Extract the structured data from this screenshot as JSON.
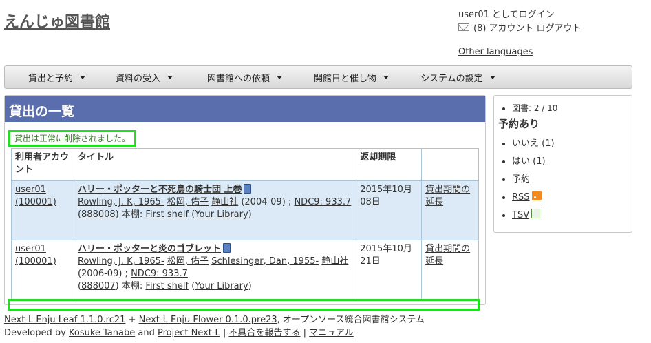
{
  "site": {
    "title": "えんじゅ図書館"
  },
  "user": {
    "login_text": "user01 としてログイン",
    "message_count": "(8)",
    "account_link": "アカウント",
    "logout_link": "ログアウト",
    "other_languages": "Other languages"
  },
  "nav": {
    "items": [
      {
        "label": "貸出と予約"
      },
      {
        "label": "資料の受入"
      },
      {
        "label": "図書館への依頼"
      },
      {
        "label": "開館日と催し物"
      },
      {
        "label": "システムの設定"
      }
    ]
  },
  "main": {
    "heading": "貸出の一覧",
    "notice": "貸出は正常に削除されました。",
    "columns": {
      "account": "利用者アカウント",
      "title": "タイトル",
      "due": "返却期限",
      "action": ""
    },
    "rows": [
      {
        "user": "user01",
        "user_number": "(100001)",
        "title": "ハリー・ポッターと不死鳥の騎士団 上巻",
        "author1": "Rowling, J. K, 1965-",
        "author2": "松岡, 佑子",
        "author3": "",
        "publisher": "静山社",
        "pub_info": " (2004-09) ; ",
        "ndc": "NDC9: 933.7",
        "item_id": "888008",
        "shelf_label": " 本棚: ",
        "shelf": "First shelf",
        "library": "Your Library",
        "due": "2015年10月08日",
        "action": "貸出期間の延長"
      },
      {
        "user": "user01",
        "user_number": "(100001)",
        "title": "ハリー・ポッターと炎のゴブレット",
        "author1": "Rowling, J. K, 1965-",
        "author2": "松岡, 佑子",
        "author3": "Schlesinger, Dan, 1955-",
        "publisher": "静山社",
        "pub_info": " (2006-09) ; ",
        "ndc": "NDC9: 933.7",
        "item_id": "888007",
        "shelf_label": " 本棚: ",
        "shelf": "First shelf",
        "library": "Your Library",
        "due": "2015年10月21日",
        "action": "貸出期間の延長"
      }
    ]
  },
  "sidebar": {
    "books_count": "図書: 2 / 10",
    "reserved_heading": "予約あり",
    "links": [
      {
        "label": "いいえ (1)"
      },
      {
        "label": "はい (1)"
      },
      {
        "label": "予約"
      },
      {
        "label": "RSS"
      },
      {
        "label": "TSV"
      }
    ]
  },
  "footer": {
    "leaf": "Next-L Enju Leaf 1.1.0.rc21",
    "plus": " + ",
    "flower": "Next-L Enju Flower 0.1.0.pre23",
    "tagline": ", オープンソース統合図書館システム",
    "developed_by": "Developed by ",
    "developer": "Kosuke Tanabe",
    "and": " and ",
    "project": "Project Next-L",
    "sep": " | ",
    "report": "不具合を報告する",
    "manual": "マニュアル"
  },
  "icons": {
    "mail": "envelope-icon",
    "book": "book-icon",
    "rss": "rss-icon",
    "tsv": "spreadsheet-icon"
  },
  "colors": {
    "header_bg": "#5a6eae",
    "row_highlight": "#dbeaf6",
    "highlight_box": "#22dd22",
    "notice_text": "#3a7a2a"
  }
}
